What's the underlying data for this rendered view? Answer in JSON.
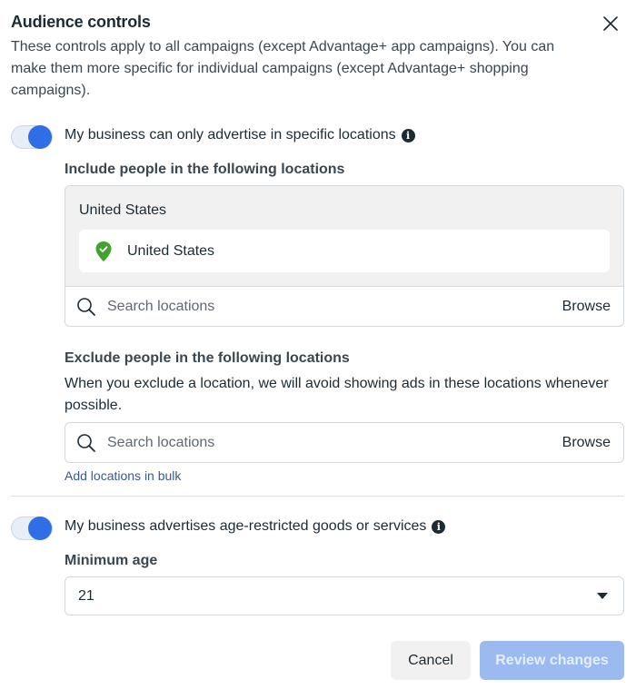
{
  "dialog": {
    "title": "Audience controls",
    "description": "These controls apply to all campaigns (except Advantage+ app campaigns). You can make them more specific for individual campaigns (except Advantage+ shopping campaigns).",
    "close_icon": "close-icon"
  },
  "locations_toggle": {
    "label": "My business can only advertise in specific locations",
    "on": true,
    "info_icon": "i"
  },
  "include": {
    "heading": "Include people in the following locations",
    "group_name": "United States",
    "locations": [
      {
        "name": "United States",
        "icon": "location-pin-check-icon",
        "status_color": "#43a22f"
      }
    ],
    "search_placeholder": "Search locations",
    "browse_label": "Browse"
  },
  "exclude": {
    "heading": "Exclude people in the following locations",
    "help": "When you exclude a location, we will avoid showing ads in these locations whenever possible.",
    "search_placeholder": "Search locations",
    "browse_label": "Browse",
    "bulk_link": "Add locations in bulk"
  },
  "age_toggle": {
    "label": "My business advertises age-restricted goods or services",
    "on": true,
    "info_icon": "i"
  },
  "minimum_age": {
    "label": "Minimum age",
    "value": "21"
  },
  "footer": {
    "cancel_label": "Cancel",
    "review_label": "Review changes",
    "review_enabled": false
  },
  "colors": {
    "accent": "#2f6ee5",
    "link": "#385898",
    "disabled_primary": "#9bbaf0"
  }
}
